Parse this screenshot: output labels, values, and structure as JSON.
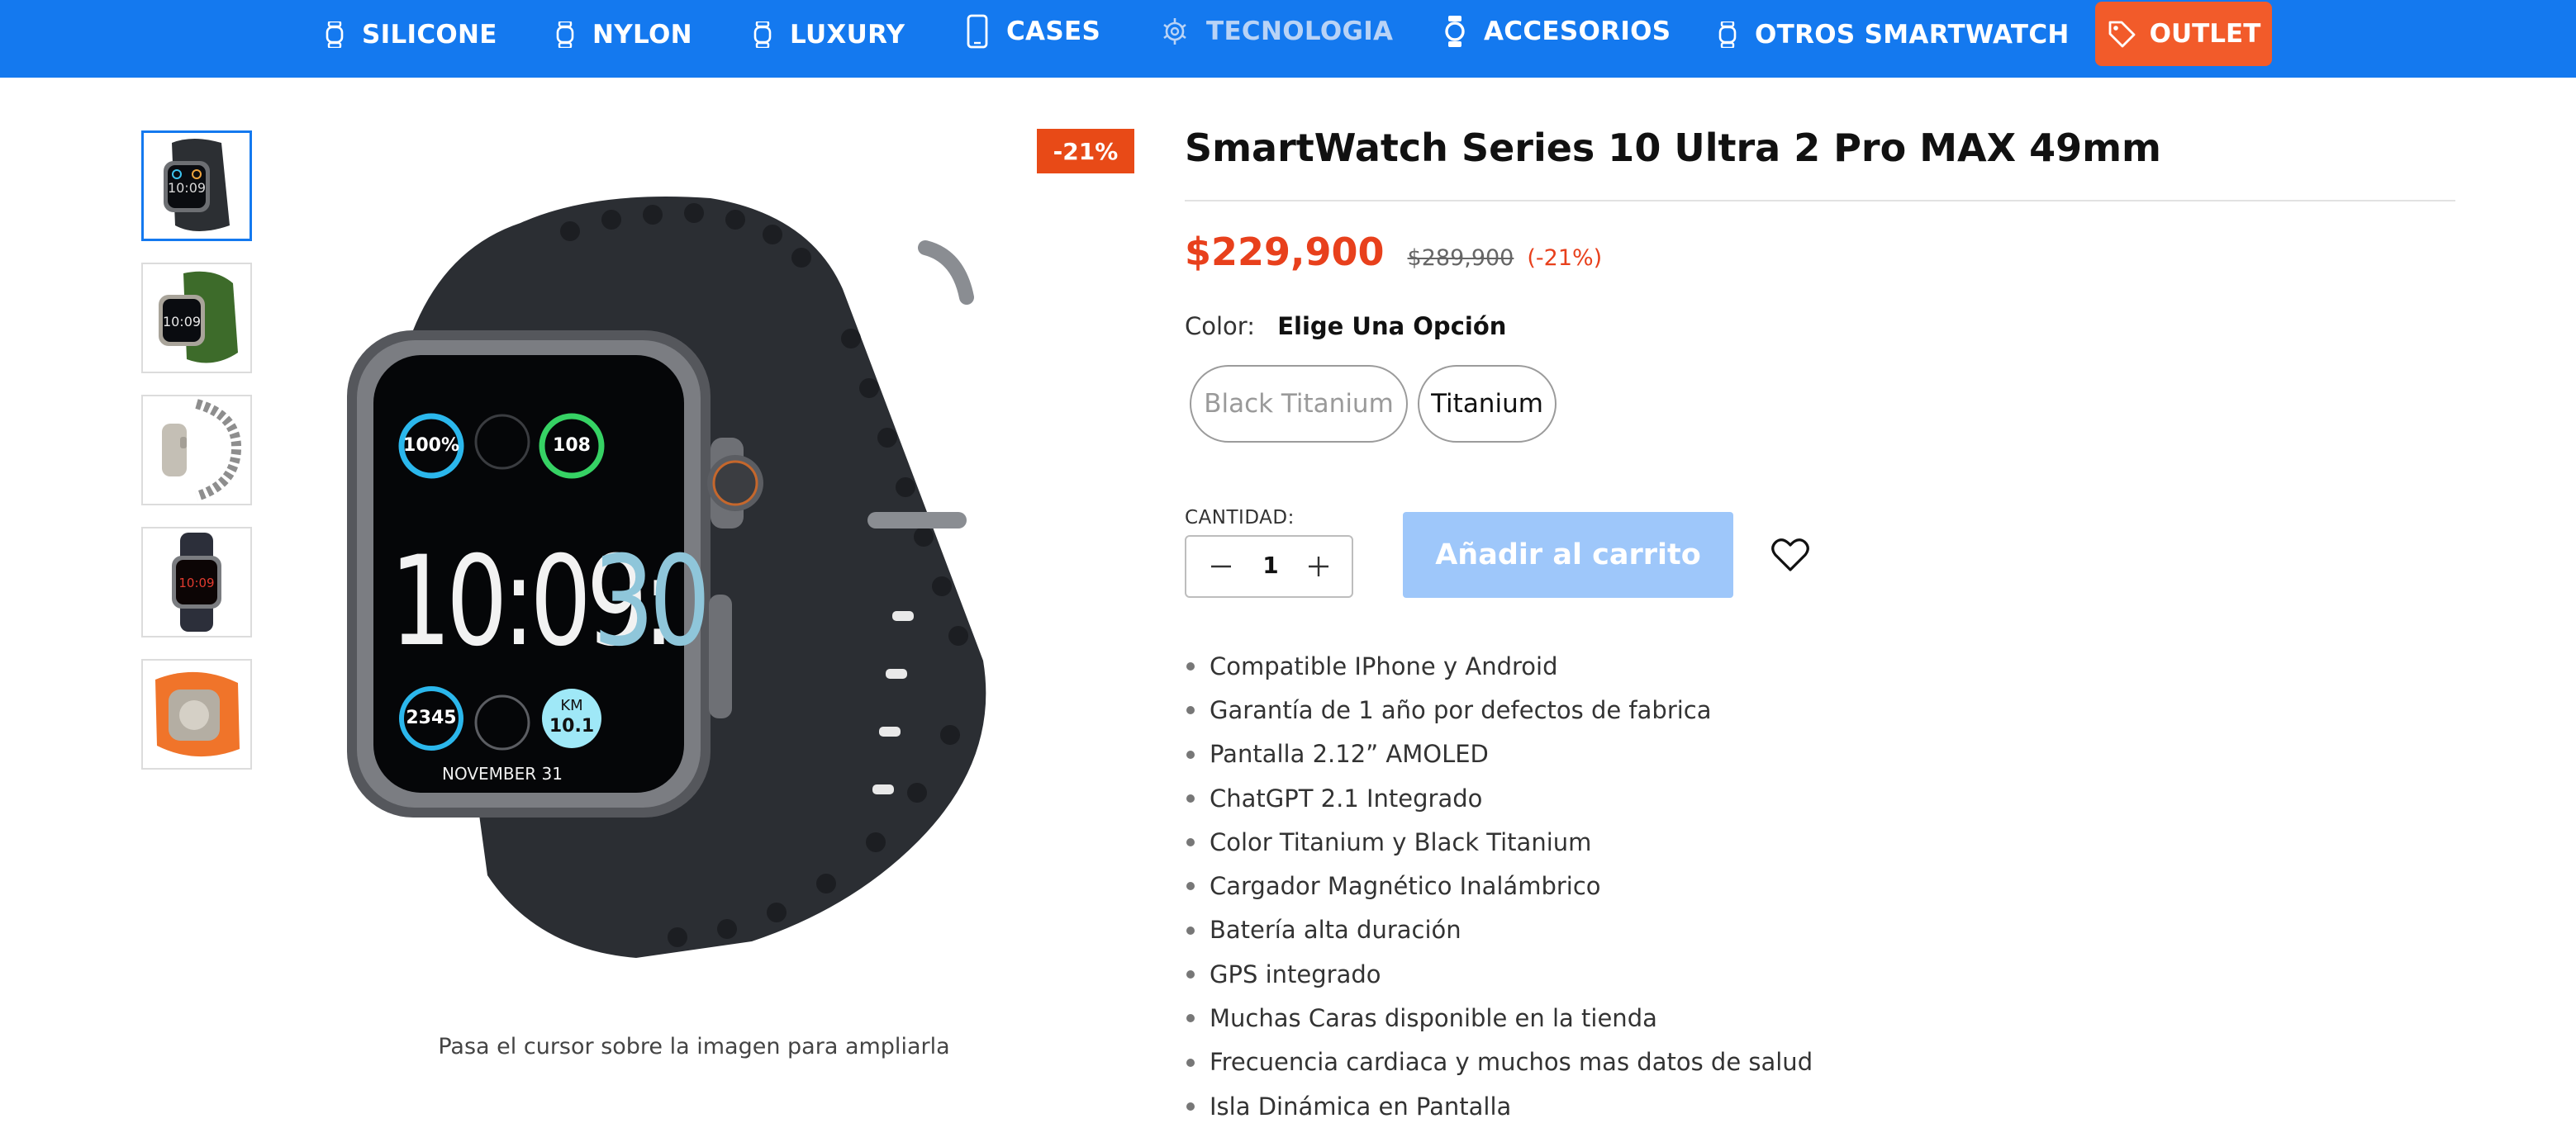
{
  "nav": {
    "items": [
      {
        "label": "SILICONE",
        "icon": "watch-icon"
      },
      {
        "label": "NYLON",
        "icon": "watch-icon"
      },
      {
        "label": "LUXURY",
        "icon": "watch-icon"
      },
      {
        "label": "CASES",
        "icon": "phone-icon"
      },
      {
        "label": "TECNOLOGIA",
        "icon": "gear-icon"
      },
      {
        "label": "ACCESORIOS",
        "icon": "watch-icon"
      },
      {
        "label": "OTROS SMARTWATCH",
        "icon": "watch-icon"
      }
    ],
    "outlet": {
      "label": "OUTLET",
      "icon": "tag-icon",
      "color": "#f25b2a"
    },
    "background": "#1479ef"
  },
  "gallery": {
    "thumbnails": [
      {
        "alt": "black-titanium-watch-thumbnail",
        "active": true
      },
      {
        "alt": "green-band-watch-thumbnail",
        "active": false
      },
      {
        "alt": "chain-band-watch-thumbnail",
        "active": false
      },
      {
        "alt": "red-face-watch-thumbnail",
        "active": false
      },
      {
        "alt": "orange-band-watch-thumbnail",
        "active": false
      }
    ],
    "main_image_face": {
      "battery": "100%",
      "heart_rate": "108",
      "time_hm": "10:09:",
      "time_s": "30",
      "steps": "2345",
      "km_label": "KM",
      "km_value": "10.1",
      "date": "NOVEMBER 31"
    },
    "discount_badge": "-21%",
    "zoom_hint": "Pasa el cursor sobre la imagen para ampliarla"
  },
  "product": {
    "title": "SmartWatch Series 10 Ultra 2 Pro MAX 49mm",
    "price_current": "$229,900",
    "price_original": "$289,900",
    "price_discount": "(-21%)",
    "price_color": "#e8401c",
    "color_label": "Color:",
    "color_prompt": "Elige Una Opción",
    "color_options": [
      {
        "label": "Black Titanium",
        "available": false
      },
      {
        "label": "Titanium",
        "available": true
      }
    ],
    "quantity_label": "CANTIDAD:",
    "quantity_value": "1",
    "add_to_cart": "Añadir al carrito",
    "add_to_cart_color": "#9ec7fa",
    "features": [
      "Compatible IPhone y Android",
      "Garantía de 1 año por defectos de fabrica",
      "Pantalla 2.12” AMOLED",
      "ChatGPT 2.1 Integrado",
      "Color Titanium y Black Titanium",
      "Cargador Magnético Inalámbrico",
      "Batería alta duración",
      "GPS integrado",
      "Muchas Caras disponible en la tienda",
      "Frecuencia cardiaca y muchos mas datos de salud",
      "Isla Dinámica en Pantalla"
    ]
  }
}
